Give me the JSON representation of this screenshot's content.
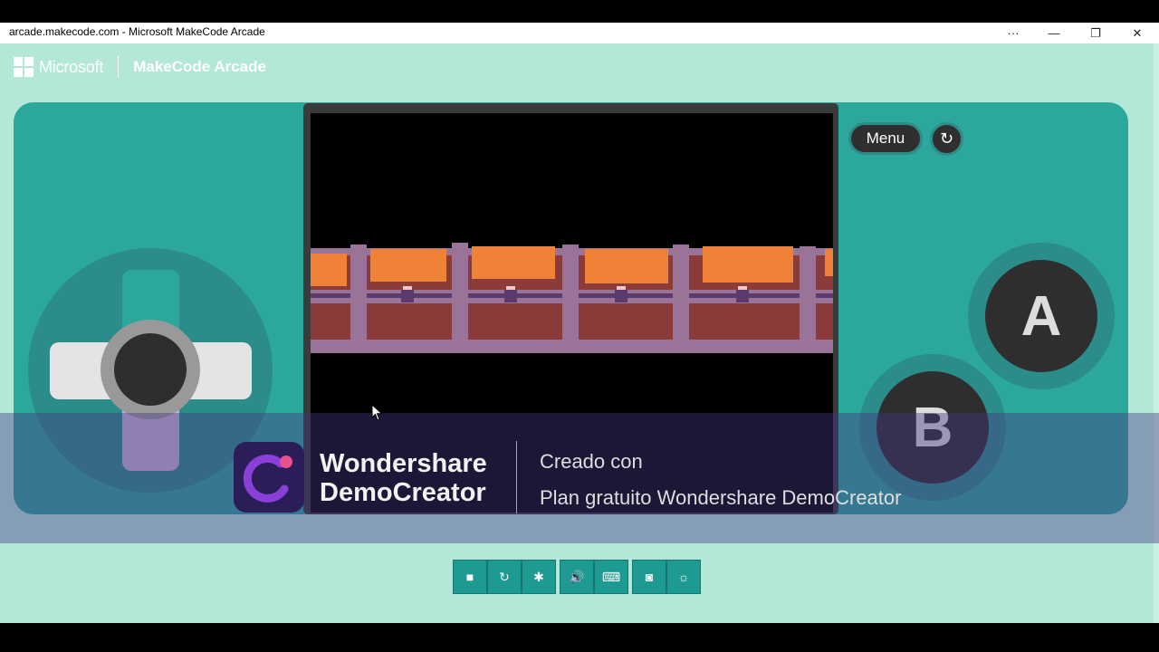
{
  "window": {
    "title": "arcade.makecode.com - Microsoft MakeCode Arcade",
    "more_label": "···",
    "minimize_label": "—",
    "restore_label": "❐",
    "close_label": "✕"
  },
  "header": {
    "brand": "Microsoft",
    "app_name": "MakeCode Arcade"
  },
  "simulator": {
    "menu_label": "Menu",
    "restart_icon": "↻",
    "a_label": "A",
    "b_label": "B"
  },
  "watermark": {
    "brand_line1": "Wondershare",
    "brand_line2": "DemoCreator",
    "line1": "Creado con",
    "line2": "Plan gratuito Wondershare DemoCreator"
  },
  "toolbar": {
    "stop_icon": "■",
    "restart_icon": "↻",
    "debug_icon": "✱",
    "mute_icon": "🔊",
    "keyboard_icon": "⌨",
    "screenshot_icon": "◙",
    "settings_icon": "☼"
  },
  "colors": {
    "background": "#b3e8d9",
    "console": "#2ba79b",
    "ring": "#2b8c8a",
    "button": "#2e2e2e",
    "toolbar": "#1d9a91"
  }
}
